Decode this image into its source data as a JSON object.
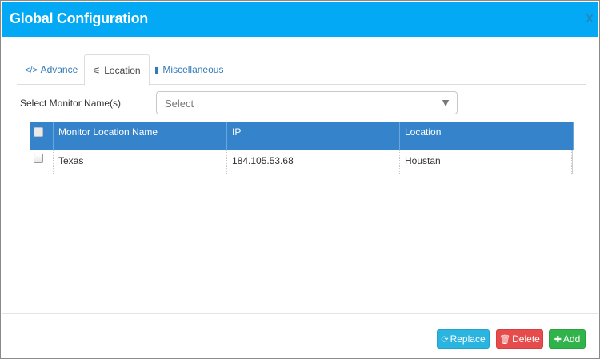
{
  "dialog": {
    "title": "Global Configuration",
    "close_label": "X"
  },
  "tabs": [
    {
      "icon": "</>",
      "label": "Advance",
      "active": false
    },
    {
      "icon": "⚟",
      "label": "Location",
      "active": true
    },
    {
      "icon": "▮",
      "label": "Miscellaneous",
      "active": false
    }
  ],
  "monitor_select": {
    "label": "Select Monitor Name(s)",
    "value": "Select",
    "arrow": "▼"
  },
  "grid": {
    "columns": [
      "Monitor Location Name",
      "IP",
      "Location"
    ],
    "rows": [
      {
        "name": "Texas",
        "ip": "184.105.53.68",
        "location": "Houstan",
        "checked": false
      }
    ]
  },
  "buttons": {
    "replace": {
      "icon": "⟳",
      "label": "Replace"
    },
    "delete": {
      "icon": "🗑",
      "label": "Delete"
    },
    "add": {
      "icon": "✚",
      "label": "Add"
    }
  },
  "colors": {
    "titlebar": "#03a9f4",
    "grid_header": "#3583ca",
    "replace": "#2ab4e0",
    "delete": "#e74c4c",
    "add": "#2fb34a"
  }
}
